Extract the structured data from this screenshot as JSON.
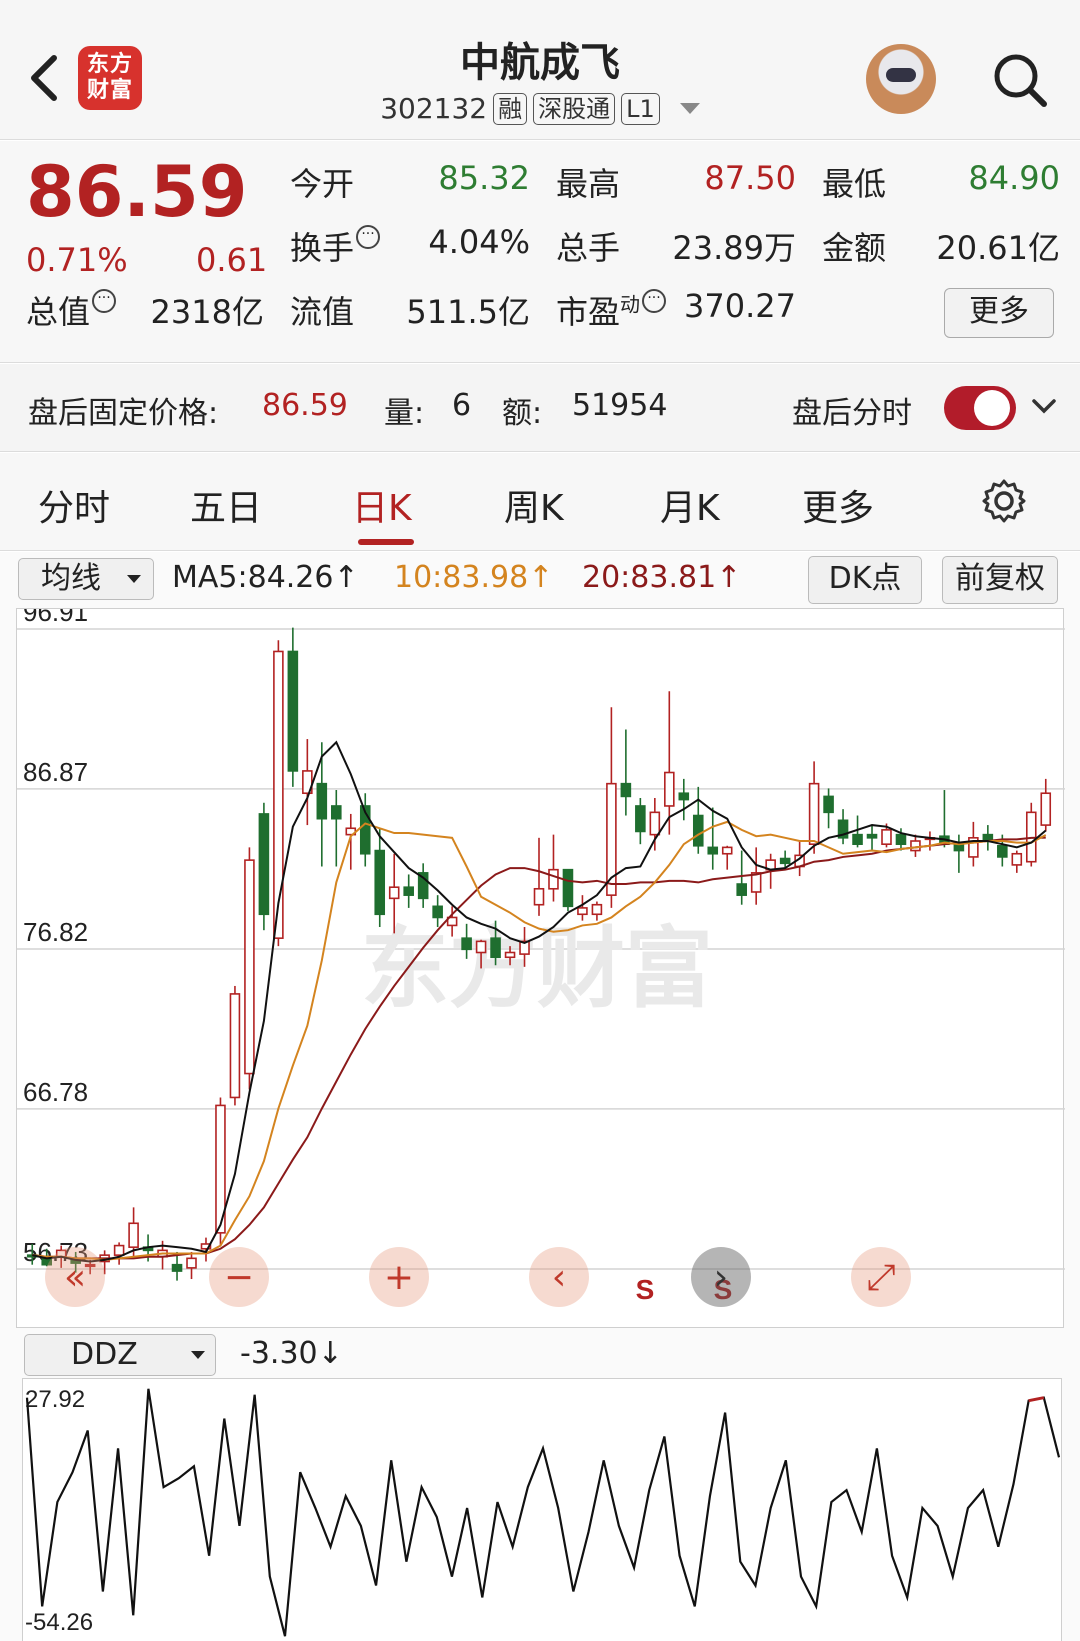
{
  "header": {
    "logo_text_1": "东方",
    "logo_text_2": "财富",
    "title": "中航成飞",
    "code": "302132",
    "tags": [
      "融",
      "深股通",
      "L1"
    ]
  },
  "quote": {
    "price": "86.59",
    "pct": "0.71%",
    "change": "0.61",
    "open_label": "今开",
    "open": "85.32",
    "high_label": "最高",
    "high": "87.50",
    "low_label": "最低",
    "low": "84.90",
    "turnover_label": "换手",
    "turnover": "4.04%",
    "volume_label": "总手",
    "volume": "23.89万",
    "amount_label": "金额",
    "amount": "20.61亿",
    "mcap_label": "总值",
    "mcap": "2318亿",
    "float_label": "流值",
    "float": "511.5亿",
    "pe_label": "市盈",
    "pe_sup": "动",
    "pe": "370.27",
    "more_button": "更多"
  },
  "after_hours": {
    "label": "盘后固定价格:",
    "price": "86.59",
    "vol_label": "量:",
    "vol": "6",
    "amt_label": "额:",
    "amt": "51954",
    "toggle_label": "盘后分时",
    "toggle_on": true
  },
  "tabs": [
    "分时",
    "五日",
    "日K",
    "周K",
    "月K",
    "更多"
  ],
  "active_tab": "日K",
  "indicators": {
    "selector": "均线",
    "ma5": "MA5:84.26↑",
    "ma10": "10:83.98↑",
    "ma20": "20:83.81↑",
    "dk_button": "DK点",
    "adjust_button": "前复权",
    "ddz_selector": "DDZ",
    "ddz_value": "-3.30↓"
  },
  "chart_data": {
    "type": "candlestick",
    "y_ticks": [
      "96.91",
      "86.87",
      "76.82",
      "66.78",
      "56.73"
    ],
    "ylim": [
      56.73,
      96.91
    ],
    "watermark": "东方财富",
    "signal_markers": [
      "S",
      "S"
    ],
    "candles": [
      {
        "o": 57.6,
        "h": 58.3,
        "l": 57.0,
        "c": 57.5
      },
      {
        "o": 57.4,
        "h": 58.0,
        "l": 56.9,
        "c": 57.0
      },
      {
        "o": 57.5,
        "h": 58.2,
        "l": 56.8,
        "c": 57.9
      },
      {
        "o": 57.3,
        "h": 57.8,
        "l": 56.5,
        "c": 57.1
      },
      {
        "o": 56.9,
        "h": 57.3,
        "l": 56.4,
        "c": 57.0
      },
      {
        "o": 57.2,
        "h": 57.9,
        "l": 56.4,
        "c": 57.6
      },
      {
        "o": 57.6,
        "h": 58.4,
        "l": 57.0,
        "c": 58.2
      },
      {
        "o": 58.1,
        "h": 60.6,
        "l": 57.4,
        "c": 59.6
      },
      {
        "o": 58.1,
        "h": 58.9,
        "l": 57.2,
        "c": 57.9
      },
      {
        "o": 57.5,
        "h": 58.5,
        "l": 56.7,
        "c": 57.9
      },
      {
        "o": 57.0,
        "h": 57.8,
        "l": 56.0,
        "c": 56.6
      },
      {
        "o": 56.8,
        "h": 57.8,
        "l": 56.1,
        "c": 57.4
      },
      {
        "o": 58.0,
        "h": 58.7,
        "l": 57.2,
        "c": 58.3
      },
      {
        "o": 59.0,
        "h": 67.5,
        "l": 58.2,
        "c": 67.0
      },
      {
        "o": 67.5,
        "h": 74.5,
        "l": 67.0,
        "c": 74.0
      },
      {
        "o": 69.0,
        "h": 83.2,
        "l": 68.0,
        "c": 82.4
      },
      {
        "o": 85.3,
        "h": 86.0,
        "l": 78.0,
        "c": 79.0
      },
      {
        "o": 77.5,
        "h": 96.2,
        "l": 77.0,
        "c": 95.5
      },
      {
        "o": 95.5,
        "h": 97.0,
        "l": 87.0,
        "c": 88.0
      },
      {
        "o": 86.6,
        "h": 90.0,
        "l": 84.6,
        "c": 88.0
      },
      {
        "o": 87.2,
        "h": 89.8,
        "l": 82.0,
        "c": 85.0
      },
      {
        "o": 85.8,
        "h": 86.8,
        "l": 82.0,
        "c": 85.0
      },
      {
        "o": 84.0,
        "h": 85.3,
        "l": 81.8,
        "c": 84.4
      },
      {
        "o": 85.8,
        "h": 86.6,
        "l": 82.0,
        "c": 82.8
      },
      {
        "o": 83.0,
        "h": 84.4,
        "l": 78.2,
        "c": 79.0
      },
      {
        "o": 80.0,
        "h": 82.8,
        "l": 77.8,
        "c": 80.7
      },
      {
        "o": 80.7,
        "h": 81.5,
        "l": 79.4,
        "c": 80.2
      },
      {
        "o": 81.6,
        "h": 82.2,
        "l": 79.4,
        "c": 80.0
      },
      {
        "o": 79.5,
        "h": 80.2,
        "l": 78.2,
        "c": 78.8
      },
      {
        "o": 78.3,
        "h": 79.5,
        "l": 77.6,
        "c": 78.8
      },
      {
        "o": 77.5,
        "h": 78.4,
        "l": 76.2,
        "c": 76.8
      },
      {
        "o": 76.6,
        "h": 77.4,
        "l": 75.6,
        "c": 77.3
      },
      {
        "o": 77.5,
        "h": 78.6,
        "l": 75.8,
        "c": 76.3
      },
      {
        "o": 76.3,
        "h": 77.0,
        "l": 75.8,
        "c": 76.6
      },
      {
        "o": 76.5,
        "h": 78.2,
        "l": 75.7,
        "c": 77.3
      },
      {
        "o": 79.6,
        "h": 83.8,
        "l": 78.9,
        "c": 80.6
      },
      {
        "o": 80.6,
        "h": 84.0,
        "l": 79.8,
        "c": 81.8
      },
      {
        "o": 81.8,
        "h": 80.8,
        "l": 79.2,
        "c": 79.5
      },
      {
        "o": 79.0,
        "h": 80.2,
        "l": 78.6,
        "c": 79.4
      },
      {
        "o": 79.0,
        "h": 79.8,
        "l": 78.6,
        "c": 79.6
      },
      {
        "o": 80.2,
        "h": 92.0,
        "l": 79.4,
        "c": 87.2
      },
      {
        "o": 87.2,
        "h": 90.6,
        "l": 85.2,
        "c": 86.4
      },
      {
        "o": 85.8,
        "h": 86.3,
        "l": 83.4,
        "c": 84.2
      },
      {
        "o": 84.0,
        "h": 86.3,
        "l": 83.0,
        "c": 85.4
      },
      {
        "o": 85.8,
        "h": 93.0,
        "l": 84.0,
        "c": 87.9
      },
      {
        "o": 86.6,
        "h": 87.5,
        "l": 84.9,
        "c": 86.2
      },
      {
        "o": 85.2,
        "h": 87.0,
        "l": 82.8,
        "c": 83.3
      },
      {
        "o": 83.2,
        "h": 85.7,
        "l": 81.8,
        "c": 82.8
      },
      {
        "o": 82.8,
        "h": 83.3,
        "l": 81.8,
        "c": 83.2
      },
      {
        "o": 80.9,
        "h": 83.0,
        "l": 79.6,
        "c": 80.2
      },
      {
        "o": 80.4,
        "h": 83.2,
        "l": 79.6,
        "c": 81.6
      },
      {
        "o": 81.8,
        "h": 82.8,
        "l": 80.6,
        "c": 82.4
      },
      {
        "o": 82.5,
        "h": 83.0,
        "l": 81.8,
        "c": 82.2
      },
      {
        "o": 82.0,
        "h": 83.6,
        "l": 81.4,
        "c": 82.7
      },
      {
        "o": 83.4,
        "h": 88.6,
        "l": 82.8,
        "c": 87.2
      },
      {
        "o": 86.4,
        "h": 86.9,
        "l": 84.4,
        "c": 85.4
      },
      {
        "o": 84.9,
        "h": 85.6,
        "l": 83.4,
        "c": 83.8
      },
      {
        "o": 84.0,
        "h": 85.2,
        "l": 83.2,
        "c": 83.4
      },
      {
        "o": 84.0,
        "h": 84.6,
        "l": 83.0,
        "c": 83.8
      },
      {
        "o": 83.4,
        "h": 84.7,
        "l": 83.2,
        "c": 84.3
      },
      {
        "o": 84.0,
        "h": 84.4,
        "l": 83.0,
        "c": 83.4
      },
      {
        "o": 83.0,
        "h": 84.0,
        "l": 82.6,
        "c": 83.6
      },
      {
        "o": 83.8,
        "h": 84.2,
        "l": 83.0,
        "c": 83.8
      },
      {
        "o": 83.9,
        "h": 86.8,
        "l": 83.2,
        "c": 83.4
      },
      {
        "o": 83.4,
        "h": 84.0,
        "l": 81.6,
        "c": 83.0
      },
      {
        "o": 82.6,
        "h": 84.8,
        "l": 82.0,
        "c": 83.8
      },
      {
        "o": 84.0,
        "h": 84.6,
        "l": 83.0,
        "c": 83.6
      },
      {
        "o": 83.3,
        "h": 84.0,
        "l": 82.0,
        "c": 82.6
      },
      {
        "o": 82.1,
        "h": 83.0,
        "l": 81.6,
        "c": 82.8
      },
      {
        "o": 82.3,
        "h": 86.0,
        "l": 82.0,
        "c": 85.4
      },
      {
        "o": 84.6,
        "h": 87.5,
        "l": 84.2,
        "c": 86.6
      }
    ],
    "ma5": [
      57.6,
      57.4,
      57.5,
      57.3,
      57.2,
      57.3,
      57.5,
      57.9,
      58.1,
      58.2,
      58.1,
      58.0,
      57.8,
      59.5,
      62.7,
      67.8,
      72.3,
      79.7,
      84.5,
      86.3,
      88.9,
      89.8,
      87.8,
      85.4,
      83.9,
      82.9,
      81.9,
      81.3,
      80.5,
      79.6,
      78.8,
      78.4,
      78.1,
      77.5,
      77.2,
      77.6,
      78.2,
      79.1,
      79.6,
      80.2,
      81.3,
      81.9,
      82.0,
      83.7,
      85.1,
      85.6,
      86.2,
      85.5,
      85.0,
      83.2,
      82.1,
      81.8,
      81.9,
      82.5,
      83.3,
      83.8,
      84.0,
      84.3,
      84.6,
      84.5,
      84.1,
      83.9,
      83.8,
      83.7,
      83.5,
      83.6,
      83.6,
      83.4,
      83.2,
      83.5,
      84.26
    ],
    "ma10": [
      57.6,
      57.5,
      57.5,
      57.4,
      57.4,
      57.3,
      57.4,
      57.5,
      57.6,
      57.7,
      57.7,
      57.7,
      57.7,
      58.2,
      59.8,
      61.3,
      63.5,
      66.8,
      69.5,
      72.0,
      76.1,
      81.0,
      83.9,
      84.7,
      84.4,
      84.1,
      84.1,
      84.0,
      83.9,
      83.8,
      82.0,
      80.1,
      79.6,
      79.1,
      78.5,
      78.1,
      77.9,
      78.0,
      78.3,
      78.4,
      78.8,
      79.5,
      80.1,
      81.0,
      82.1,
      83.4,
      84.0,
      84.5,
      84.8,
      84.3,
      83.9,
      84.0,
      83.8,
      83.6,
      83.6,
      83.2,
      82.8,
      82.9,
      83.0,
      82.9,
      83.1,
      83.2,
      83.3,
      83.5,
      83.4,
      83.5,
      83.6,
      83.6,
      83.5,
      83.5,
      83.98
    ],
    "ma20": [
      57.6,
      57.5,
      57.5,
      57.4,
      57.4,
      57.4,
      57.4,
      57.4,
      57.5,
      57.5,
      57.6,
      57.7,
      57.7,
      58.0,
      58.6,
      59.5,
      60.6,
      62.1,
      63.6,
      65.0,
      66.8,
      68.5,
      70.2,
      71.8,
      73.2,
      74.5,
      75.7,
      76.9,
      78.0,
      79.0,
      79.9,
      80.8,
      81.5,
      81.9,
      81.9,
      81.7,
      81.4,
      81.1,
      81.0,
      81.1,
      80.9,
      80.9,
      81.0,
      81.0,
      81.1,
      81.1,
      81.0,
      81.2,
      81.3,
      81.4,
      81.5,
      81.7,
      81.8,
      82.0,
      82.3,
      82.4,
      82.6,
      82.7,
      82.8,
      83.0,
      83.1,
      83.2,
      83.3,
      83.4,
      83.5,
      83.5,
      83.6,
      83.7,
      83.7,
      83.8,
      83.81
    ],
    "ddz": {
      "y_ticks": [
        "27.92",
        "-54.26"
      ],
      "ylim": [
        -54.26,
        27.92
      ],
      "values": [
        25,
        -45,
        -10,
        0,
        14,
        -40,
        8,
        -48,
        28,
        -5,
        -2,
        2,
        -28,
        18,
        -18,
        26,
        -35,
        -55,
        0,
        -12,
        -25,
        -8,
        -18,
        -38,
        4,
        -30,
        -5,
        -15,
        -35,
        -12,
        -42,
        -10,
        -25,
        -5,
        8,
        -12,
        -40,
        -20,
        4,
        -18,
        -32,
        -6,
        12,
        -28,
        -45,
        -8,
        20,
        -30,
        -38,
        -12,
        4,
        -35,
        -45,
        -10,
        -6,
        -20,
        8,
        -28,
        -42,
        -12,
        -18,
        -35,
        -12,
        -6,
        -25,
        -4,
        24,
        25,
        5
      ]
    }
  }
}
